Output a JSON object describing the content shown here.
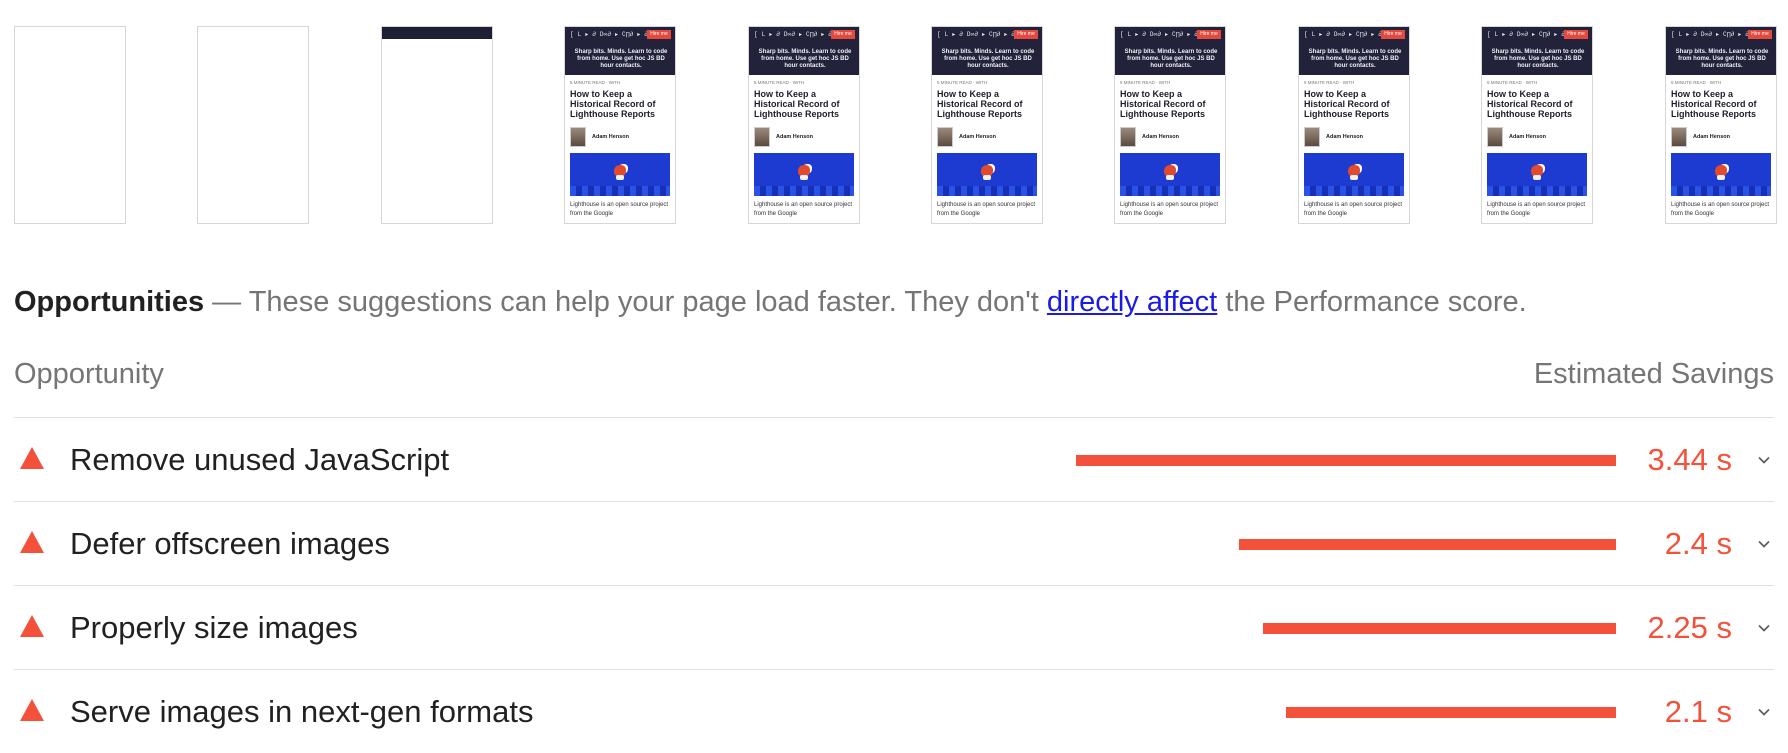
{
  "filmstrip": {
    "frames": [
      {
        "state": "blank"
      },
      {
        "state": "blank"
      },
      {
        "state": "header"
      },
      {
        "state": "full"
      },
      {
        "state": "full"
      },
      {
        "state": "full"
      },
      {
        "state": "full"
      },
      {
        "state": "full"
      },
      {
        "state": "full"
      },
      {
        "state": "full"
      }
    ],
    "thumb": {
      "logo": "[ L ▸ ∂ D∞∂ ▸ C∏∂ ▸ ∂ ( ▲ ]",
      "hire": "Hire me",
      "tagline": "Sharp bits. Minds. Learn to code from home. Use get hoc JS BD hour contacts.",
      "crumb": "5 MINUTE READ · WITH",
      "title": "How to Keep a Historical Record of Lighthouse Reports",
      "author": "Adam Henson",
      "paragraph": "Lighthouse is an open source project from the Google"
    }
  },
  "opportunities": {
    "title": "Opportunities",
    "separator": "—",
    "desc_before": "These suggestions can help your page load faster. They don't",
    "link_text": "directly affect",
    "desc_after": "the Performance score."
  },
  "table": {
    "col_opportunity": "Opportunity",
    "col_savings": "Estimated Savings"
  },
  "rows": [
    {
      "label": "Remove unused JavaScript",
      "savings": "3.44 s",
      "seconds": 3.44
    },
    {
      "label": "Defer offscreen images",
      "savings": "2.4 s",
      "seconds": 2.4
    },
    {
      "label": "Properly size images",
      "savings": "2.25 s",
      "seconds": 2.25
    },
    {
      "label": "Serve images in next-gen formats",
      "savings": "2.1 s",
      "seconds": 2.1
    }
  ],
  "colors": {
    "fail": "#f4513a",
    "link": "#1a1ae6",
    "muted": "#757575",
    "text": "#212121"
  },
  "icons": {
    "row_status": "warning-triangle-icon",
    "row_expand": "chevron-down-icon"
  }
}
